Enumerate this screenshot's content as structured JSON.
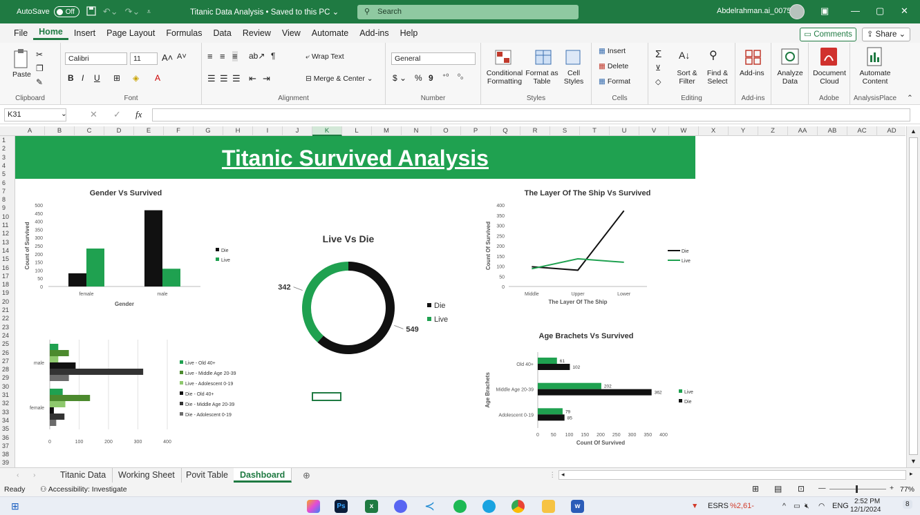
{
  "titlebar": {
    "autosave_label": "AutoSave",
    "autosave_state": "Off",
    "doc_title": "Titanic Data Analysis • Saved to this PC ⌄",
    "search_placeholder": "Search",
    "user_name": "Abdelrahman.ai_0075"
  },
  "menu": {
    "items": [
      "File",
      "Home",
      "Insert",
      "Page Layout",
      "Formulas",
      "Data",
      "Review",
      "View",
      "Automate",
      "Add-ins",
      "Help"
    ],
    "comments": "Comments",
    "share": "Share"
  },
  "ribbon": {
    "clipboard": {
      "label": "Clipboard",
      "paste": "Paste"
    },
    "font": {
      "label": "Font",
      "name": "Calibri",
      "size": "11"
    },
    "alignment": {
      "label": "Alignment",
      "wrap": "Wrap Text",
      "merge": "Merge & Center"
    },
    "number": {
      "label": "Number",
      "format": "General"
    },
    "styles": {
      "label": "Styles",
      "conditional": "Conditional Formatting",
      "format_table": "Format as Table",
      "cell_styles": "Cell Styles"
    },
    "cells": {
      "label": "Cells",
      "insert": "Insert",
      "delete": "Delete",
      "format": "Format"
    },
    "editing": {
      "label": "Editing",
      "sort": "Sort & Filter",
      "find": "Find & Select"
    },
    "addins": {
      "label": "Add-ins",
      "btn": "Add-ins"
    },
    "analyze": {
      "btn": "Analyze Data"
    },
    "adobe": {
      "label": "Adobe",
      "btn": "Document Cloud"
    },
    "analysisplace": {
      "label": "AnalysisPlace",
      "btn": "Automate Content"
    }
  },
  "formula": {
    "cell_ref": "K31",
    "fx": "fx",
    "value": ""
  },
  "columns": [
    "A",
    "B",
    "C",
    "D",
    "E",
    "F",
    "G",
    "H",
    "I",
    "J",
    "K",
    "L",
    "M",
    "N",
    "O",
    "P",
    "Q",
    "R",
    "S",
    "T",
    "U",
    "V",
    "W",
    "X",
    "Y",
    "Z",
    "AA",
    "AB",
    "AC",
    "AD"
  ],
  "selected_column": "K",
  "rows": [
    "1",
    "2",
    "3",
    "4",
    "5",
    "6",
    "7",
    "8",
    "9",
    "10",
    "11",
    "12",
    "13",
    "14",
    "15",
    "16",
    "17",
    "18",
    "19",
    "20",
    "21",
    "22",
    "23",
    "24",
    "25",
    "26",
    "27",
    "28",
    "29",
    "30",
    "31",
    "32",
    "33",
    "34",
    "35",
    "36",
    "37",
    "38",
    "39"
  ],
  "dashboard": {
    "title": "Titanic Survived Analysis"
  },
  "sheets": {
    "tabs": [
      "Titanic Data",
      "Working Sheet",
      "Povit Table",
      "Dashboard"
    ],
    "active": "Dashboard"
  },
  "status": {
    "ready": "Ready",
    "accessibility": "Accessibility: Investigate",
    "zoom": "77%"
  },
  "taskbar": {
    "ticker": "ESRS",
    "ticker_change": "%2,61-",
    "lang": "ENG",
    "time": "2:52 PM",
    "date": "12/1/2024",
    "badge": "8"
  },
  "colors": {
    "die": "#111111",
    "live": "#1fa150",
    "live_light": "#8ec86d",
    "live_mid": "#4c8a2e",
    "die_mid": "#333333",
    "die_light": "#6b6b6b",
    "banner": "#1fa150",
    "excel_green": "#1f7a42"
  },
  "chart_data": [
    {
      "id": "gender",
      "type": "bar",
      "title": "Gender Vs Survived",
      "xlabel": "Gender",
      "ylabel": "Count of Survived",
      "categories": [
        "female",
        "male"
      ],
      "series": [
        {
          "name": "Die",
          "values": [
            81,
            468
          ]
        },
        {
          "name": "Live",
          "values": [
            233,
            109
          ]
        }
      ],
      "ylim": [
        0,
        500
      ],
      "yticks": [
        0,
        50,
        100,
        150,
        200,
        250,
        300,
        350,
        400,
        450,
        500
      ],
      "legend": "right"
    },
    {
      "id": "livedie",
      "type": "pie",
      "variant": "donut",
      "title": "Live Vs Die",
      "labels": [
        "Die",
        "Live"
      ],
      "values": [
        549,
        342
      ],
      "legend": "right"
    },
    {
      "id": "layer",
      "type": "line",
      "title": "The Layer Of The Ship Vs Survived",
      "xlabel": "The Layer Of The Ship",
      "ylabel": "Count Of Survived",
      "categories": [
        "Middle",
        "Upper",
        "Lower"
      ],
      "series": [
        {
          "name": "Die",
          "values": [
            97,
            80,
            372
          ]
        },
        {
          "name": "Live",
          "values": [
            87,
            136,
            119
          ]
        }
      ],
      "ylim": [
        0,
        400
      ],
      "yticks": [
        0,
        50,
        100,
        150,
        200,
        250,
        300,
        350,
        400
      ],
      "legend": "right"
    },
    {
      "id": "agegender",
      "type": "bar",
      "orientation": "horizontal",
      "categories": [
        "male",
        "female"
      ],
      "series": [
        {
          "name": "Live - Old 40+",
          "values": [
            29,
            44
          ]
        },
        {
          "name": "Live - Middle Age 20-39",
          "values": [
            65,
            137
          ]
        },
        {
          "name": "Live - Adolescent 0-19",
          "values": [
            29,
            53
          ]
        },
        {
          "name": "Die - Old 40+",
          "values": [
            88,
            14
          ]
        },
        {
          "name": "Die - Middle Age 20-39",
          "values": [
            318,
            50
          ]
        },
        {
          "name": "Die - Adolescent 0-19",
          "values": [
            65,
            22
          ]
        }
      ],
      "xlim": [
        0,
        400
      ],
      "xticks": [
        0,
        100,
        200,
        300,
        400
      ],
      "legend": "right"
    },
    {
      "id": "age",
      "type": "bar",
      "orientation": "horizontal",
      "title": "Age Brachets Vs Survived",
      "xlabel": "Count Of Survived",
      "ylabel": "Age Brachets",
      "categories": [
        "Old 40+",
        "Middle Age 20-39",
        "Adolescent 0-19"
      ],
      "series": [
        {
          "name": "Live",
          "values": [
            61,
            202,
            79
          ]
        },
        {
          "name": "Die",
          "values": [
            102,
            362,
            85
          ]
        }
      ],
      "xlim": [
        0,
        400
      ],
      "xticks": [
        0,
        50,
        100,
        150,
        200,
        250,
        300,
        350,
        400
      ],
      "legend": "right"
    }
  ]
}
